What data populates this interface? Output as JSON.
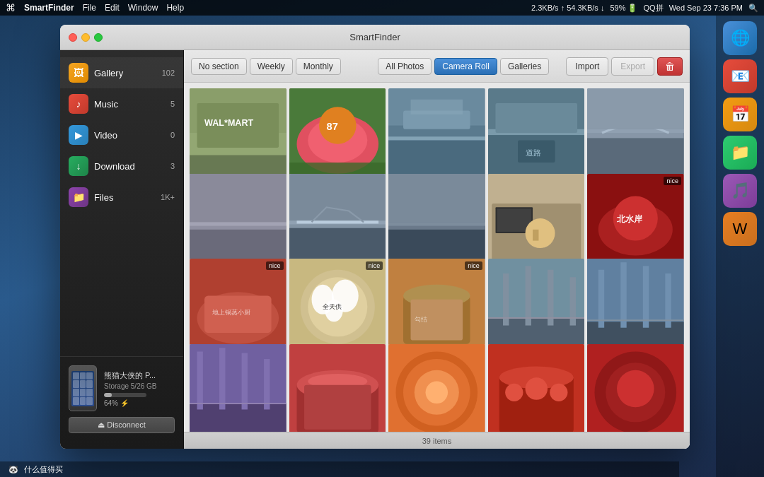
{
  "menubar": {
    "apple": "⌘",
    "app_name": "SmartFinder",
    "menus": [
      "File",
      "Edit",
      "Window",
      "Help"
    ],
    "right_items": [
      "2.3KB/s",
      "54.3KB/s",
      "59%",
      "QQ拼",
      "Wed Sep 23",
      "7:36 PM"
    ]
  },
  "window": {
    "title": "SmartFinder"
  },
  "sidebar": {
    "items": [
      {
        "id": "gallery",
        "label": "Gallery",
        "count": "102",
        "icon": "🖼"
      },
      {
        "id": "music",
        "label": "Music",
        "count": "5",
        "icon": "♪"
      },
      {
        "id": "video",
        "label": "Video",
        "count": "0",
        "icon": "▶"
      },
      {
        "id": "download",
        "label": "Download",
        "count": "3",
        "icon": "↓"
      },
      {
        "id": "files",
        "label": "Files",
        "count": "1K+",
        "icon": "📁"
      }
    ],
    "device": {
      "name": "熊猫大侠的 P...",
      "storage_label": "Storage 5/26 GB",
      "battery": "64% ⚡",
      "disconnect_label": "⏏ Disconnect"
    }
  },
  "toolbar": {
    "section_tabs": [
      {
        "id": "no-section",
        "label": "No section",
        "active": false
      },
      {
        "id": "weekly",
        "label": "Weekly",
        "active": false
      },
      {
        "id": "monthly",
        "label": "Monthly",
        "active": false
      }
    ],
    "view_tabs": [
      {
        "id": "all-photos",
        "label": "All Photos",
        "active": false
      },
      {
        "id": "camera-roll",
        "label": "Camera Roll",
        "active": true
      },
      {
        "id": "galleries",
        "label": "Galleries",
        "active": false
      }
    ],
    "import_label": "Import",
    "export_label": "Export",
    "delete_label": "🗑"
  },
  "photos": {
    "count_label": "39 items",
    "grid": [
      {
        "id": "p1",
        "bg": "#8a9e6a",
        "desc": "Walmart store exterior",
        "nice": false
      },
      {
        "id": "p2",
        "bg": "#c94060",
        "desc": "Floral decoration arch",
        "nice": false
      },
      {
        "id": "p3",
        "bg": "#6a8a9e",
        "desc": "City elevated road",
        "nice": false
      },
      {
        "id": "p4",
        "bg": "#4a6a7a",
        "desc": "Overpass road scene",
        "nice": false
      },
      {
        "id": "p5",
        "bg": "#7a8a9a",
        "desc": "River bridge twilight",
        "nice": false
      },
      {
        "id": "p6",
        "bg": "#8a9aaa",
        "desc": "Overcast river view",
        "nice": false
      },
      {
        "id": "p7",
        "bg": "#6a7a8a",
        "desc": "River bridge grey",
        "nice": false
      },
      {
        "id": "p8",
        "bg": "#5a7a8a",
        "desc": "River bridge",
        "nice": false
      },
      {
        "id": "p9",
        "bg": "#c0a060",
        "desc": "Keyboard with toy",
        "nice": false
      },
      {
        "id": "p10",
        "bg": "#8a2020",
        "desc": "Hot pot dish",
        "nice": true
      },
      {
        "id": "p11",
        "bg": "#c05040",
        "desc": "Red chili dish",
        "nice": true
      },
      {
        "id": "p12",
        "bg": "#d0c090",
        "desc": "Steamed dumplings",
        "nice": true
      },
      {
        "id": "p13",
        "bg": "#c08040",
        "desc": "Braised pork",
        "nice": true
      },
      {
        "id": "p14",
        "bg": "#7090a0",
        "desc": "Construction cranes",
        "nice": false
      },
      {
        "id": "p15",
        "bg": "#6080a0",
        "desc": "Construction cranes",
        "nice": false
      },
      {
        "id": "p16",
        "bg": "#7060a0",
        "desc": "Construction cranes",
        "nice": false
      },
      {
        "id": "p17",
        "bg": "#c04040",
        "desc": "Red vegetable dish",
        "nice": false
      },
      {
        "id": "p18",
        "bg": "#e07030",
        "desc": "Orange spicy soup",
        "nice": false
      },
      {
        "id": "p19",
        "bg": "#c03020",
        "desc": "Hotpot dish",
        "nice": false
      },
      {
        "id": "p20",
        "bg": "#b02020",
        "desc": "Red stew",
        "nice": false
      }
    ]
  }
}
